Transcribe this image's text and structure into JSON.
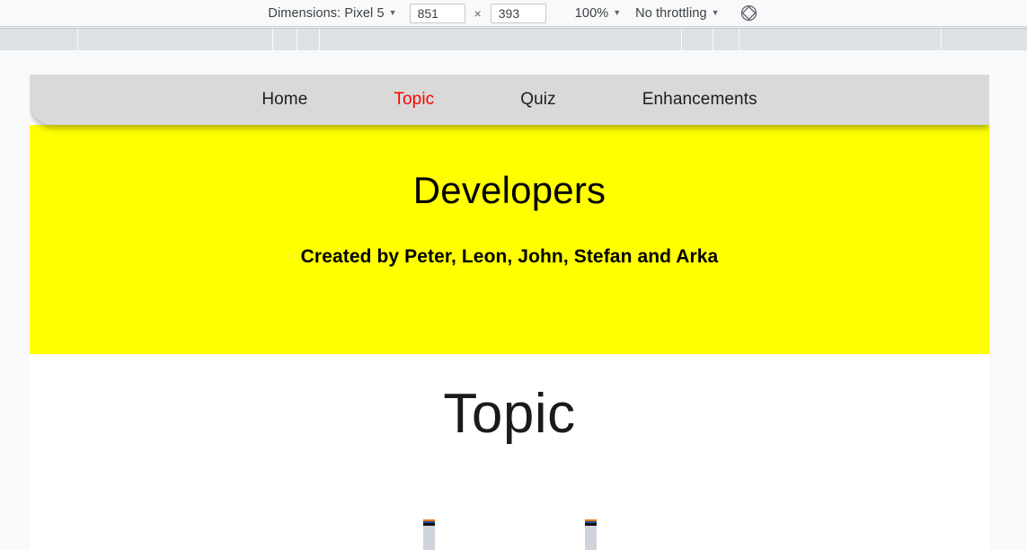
{
  "devtools_toolbar": {
    "device_label": "Dimensions: Pixel 5",
    "device_caret": "▼",
    "width_value": "851",
    "height_value": "393",
    "dim_separator": "×",
    "zoom_label": "100%",
    "zoom_caret": "▼",
    "throttle_label": "No throttling",
    "throttle_caret": "▼",
    "rotate_icon": "rotate-device-icon",
    "background_color": "#f8f9fa",
    "ruler_color": "#dee1e6"
  },
  "ruler": {
    "tick_positions": [
      86,
      303,
      330,
      355,
      758,
      793,
      822,
      1047
    ]
  },
  "page": {
    "nav": {
      "items": [
        {
          "label": "Home",
          "active": false
        },
        {
          "label": "Topic",
          "active": true
        },
        {
          "label": "Quiz",
          "active": false
        },
        {
          "label": "Enhancements",
          "active": false
        }
      ],
      "background_color": "#d9d9d9",
      "active_color": "#ff0000"
    },
    "hero": {
      "title": "Developers",
      "subtitle": "Created by Peter, Leon, John, Stefan and Arka",
      "background_color": "#ffff00",
      "text_color": "#000000"
    },
    "content": {
      "title": "Topic",
      "background_color": "#ffffff",
      "thumbnails": [
        {
          "name": "thumbnail-image-1"
        },
        {
          "name": "thumbnail-image-2"
        }
      ]
    }
  }
}
